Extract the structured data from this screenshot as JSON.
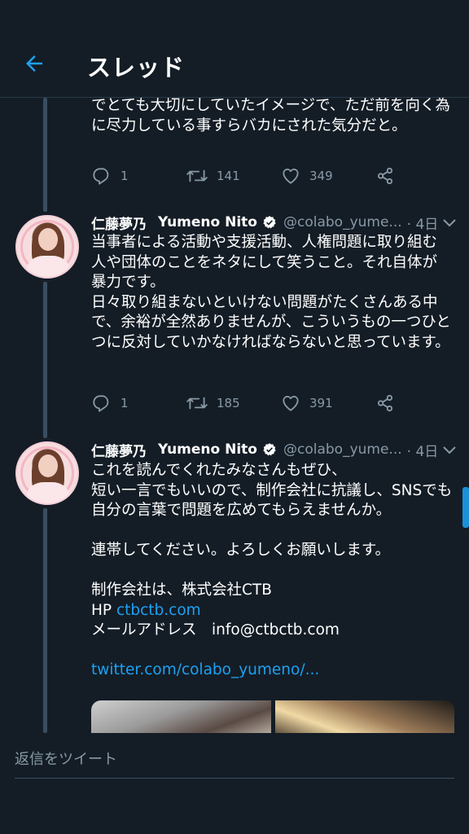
{
  "header": {
    "title": "スレッド",
    "back_icon": "arrow-left-icon"
  },
  "colors": {
    "background": "#141d26",
    "accent": "#1da1f2",
    "muted": "#8899a6",
    "thread_line": "#3a4d60"
  },
  "tweets": [
    {
      "text_lines": [
        "でとても大切にしていたイメージで、ただ前を向く為",
        "に尽力している事すらバカにされた気分だと。"
      ],
      "actions": {
        "reply": "1",
        "retweet": "141",
        "like": "349"
      }
    },
    {
      "display_name": "仁藤夢乃",
      "display_name_en": "Yumeno Nito",
      "handle": "@colabo_yume...",
      "time": "· 4日",
      "text_lines": [
        "当事者による活動や支援活動、人権問題に取り組む",
        "人や団体のことをネタにして笑うこと。それ自体が",
        "暴力です。",
        "日々取り組まないといけない問題がたくさんある中",
        "で、余裕が全然ありませんが、こういうもの一つひと",
        "つに反対していかなければならないと思っています。"
      ],
      "actions": {
        "reply": "1",
        "retweet": "185",
        "like": "391"
      }
    },
    {
      "display_name": "仁藤夢乃",
      "display_name_en": "Yumeno Nito",
      "handle": "@colabo_yume...",
      "time": "· 4日",
      "text_lines": [
        "これを読んでくれたみなさんもぜひ、",
        "短い一言でもいいので、制作会社に抗議し、SNSでも",
        "自分の言葉で問題を広めてもらえませんか。",
        "",
        "連帯してください。よろしくお願いします。",
        "",
        "制作会社は、株式会社CTB"
      ],
      "hp_label": "HP ",
      "hp_link": "ctbctb.com",
      "mail_line": "メールアドレス　info@ctbctb.com",
      "twitter_link": "twitter.com/colabo_yumeno/..."
    }
  ],
  "reply_bar": {
    "placeholder": "返信をツイート"
  }
}
